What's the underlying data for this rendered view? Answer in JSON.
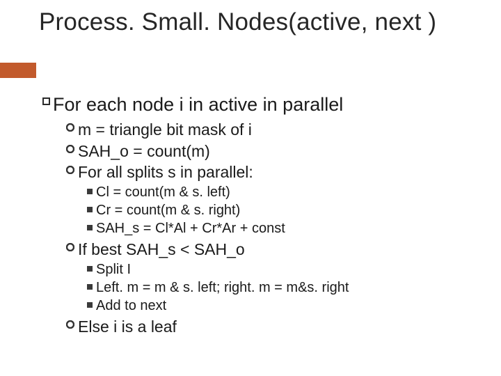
{
  "title": "Process. Small. Nodes(active, next )",
  "l1": {
    "text": "For each node i in active in parallel"
  },
  "l2a": [
    "m = triangle bit mask of i",
    "SAH_o = count(m)",
    "For all splits s in parallel:"
  ],
  "l3a": [
    "Cl = count(m & s. left)",
    "Cr = count(m & s. right)",
    "SAH_s = Cl*Al + Cr*Ar + const"
  ],
  "l2b": [
    "If best SAH_s < SAH_o"
  ],
  "l3b": [
    "Split I",
    "Left. m = m & s. left; right. m = m&s. right",
    "Add to next"
  ],
  "l2c": [
    "Else i is a leaf"
  ]
}
